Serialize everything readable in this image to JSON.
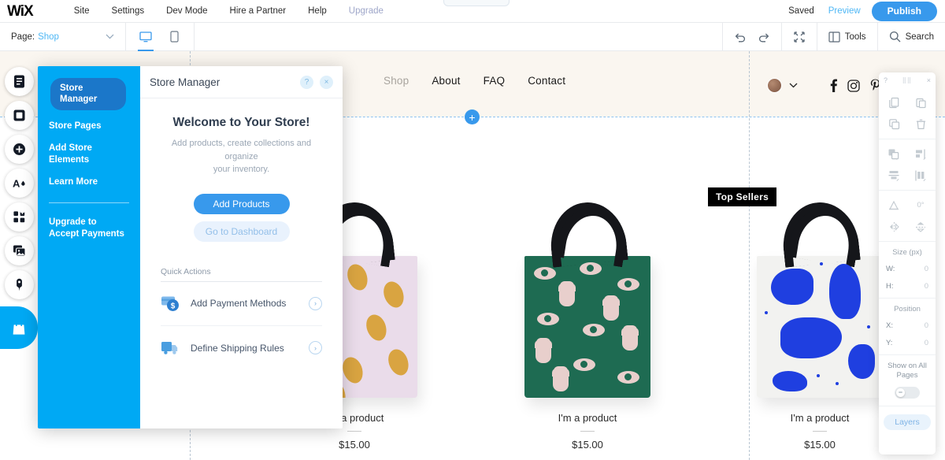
{
  "topbar": {
    "logo": "WiX",
    "menu": [
      {
        "label": "Site"
      },
      {
        "label": "Settings"
      },
      {
        "label": "Dev Mode"
      },
      {
        "label": "Hire a Partner"
      },
      {
        "label": "Help"
      },
      {
        "label": "Upgrade"
      }
    ],
    "saved_label": "Saved",
    "preview_label": "Preview",
    "publish_label": "Publish",
    "center_tab_label": ""
  },
  "secondbar": {
    "page_label": "Page:",
    "page_value": "Shop",
    "chevron": "∨",
    "desktop_icon": "desktop-icon",
    "mobile_icon": "mobile-icon",
    "undo_icon": "undo-icon",
    "redo_icon": "redo-icon",
    "zoomout_icon": "zoom-out-icon",
    "tools_label": "Tools",
    "search_label": "Search"
  },
  "left_rail": {
    "items": [
      {
        "icon": "menus-pages-icon"
      },
      {
        "icon": "sections-icon"
      },
      {
        "icon": "add-elements-icon"
      },
      {
        "icon": "site-design-icon"
      },
      {
        "icon": "app-market-icon"
      },
      {
        "icon": "media-icon"
      },
      {
        "icon": "content-manager-icon"
      }
    ],
    "store_tab_icon": "shopping-bag-icon"
  },
  "site": {
    "nav": [
      {
        "label": "Shop",
        "active": true
      },
      {
        "label": "About",
        "active": false
      },
      {
        "label": "FAQ",
        "active": false
      },
      {
        "label": "Contact",
        "active": false
      }
    ],
    "socials": [
      "facebook-icon",
      "instagram-icon",
      "pinterest-icon"
    ],
    "avatar": "user-avatar",
    "avatar_chevron": "∨",
    "section_badge": "Top Sellers",
    "add_section_icon": "+",
    "products": [
      {
        "name": "I'm a product",
        "price": "$15.00",
        "style": "lemon-tote"
      },
      {
        "name": "I'm a product",
        "price": "$15.00",
        "style": "eyes-hands-tote"
      },
      {
        "name": "I'm a product",
        "price": "$15.00",
        "style": "blue-blob-tote"
      }
    ]
  },
  "store_manager": {
    "title": "Store Manager",
    "help_icon": "?",
    "close_icon": "×",
    "side_items": [
      {
        "label": "Store Manager",
        "active": true
      },
      {
        "label": "Store Pages",
        "active": false
      },
      {
        "label": "Add Store Elements",
        "active": false
      },
      {
        "label": "Learn More",
        "active": false
      }
    ],
    "side_footer": "Upgrade to\nAccept Payments",
    "side_footer_line1": "Upgrade to",
    "side_footer_line2": "Accept Payments",
    "welcome_title": "Welcome to Your Store!",
    "welcome_sub_line1": "Add products, create collections and organize",
    "welcome_sub_line2": "your inventory.",
    "primary_btn": "Add Products",
    "secondary_btn": "Go to Dashboard",
    "quick_actions_title": "Quick Actions",
    "quick_actions": [
      {
        "label": "Add Payment Methods",
        "icon": "payment-card-icon",
        "arrow": "›"
      },
      {
        "label": "Define Shipping Rules",
        "icon": "shipping-truck-icon",
        "arrow": "›"
      }
    ]
  },
  "right_toolbar": {
    "help_icon": "?",
    "grip_icon": "drag-grip",
    "close_icon": "×",
    "actions_row1": [
      "copy-icon",
      "paste-icon"
    ],
    "actions_row2": [
      "duplicate-icon",
      "delete-icon"
    ],
    "arrange_row1": [
      "arrange-icon",
      "align-horizontal-icon"
    ],
    "arrange_row2": [
      "align-vertical-icon",
      "distribute-icon"
    ],
    "rotate_icon": "rotate-icon",
    "rotate_value": "0°",
    "flip_h_icon": "flip-horizontal-icon",
    "flip_v_icon": "flip-vertical-icon",
    "size_label": "Size (px)",
    "width_key": "W:",
    "width_value": "0",
    "height_key": "H:",
    "height_value": "0",
    "position_label": "Position",
    "x_key": "X:",
    "x_value": "0",
    "y_key": "Y:",
    "y_value": "0",
    "show_all_line1": "Show on All",
    "show_all_line2": "Pages",
    "toggle_state": "off",
    "layers_label": "Layers"
  },
  "colors": {
    "wix_blue": "#3899ec",
    "panel_blue": "#00a9f4",
    "active_item_blue": "#1b77c9",
    "header_cream": "#faf6f0",
    "badge_black": "#000000"
  }
}
